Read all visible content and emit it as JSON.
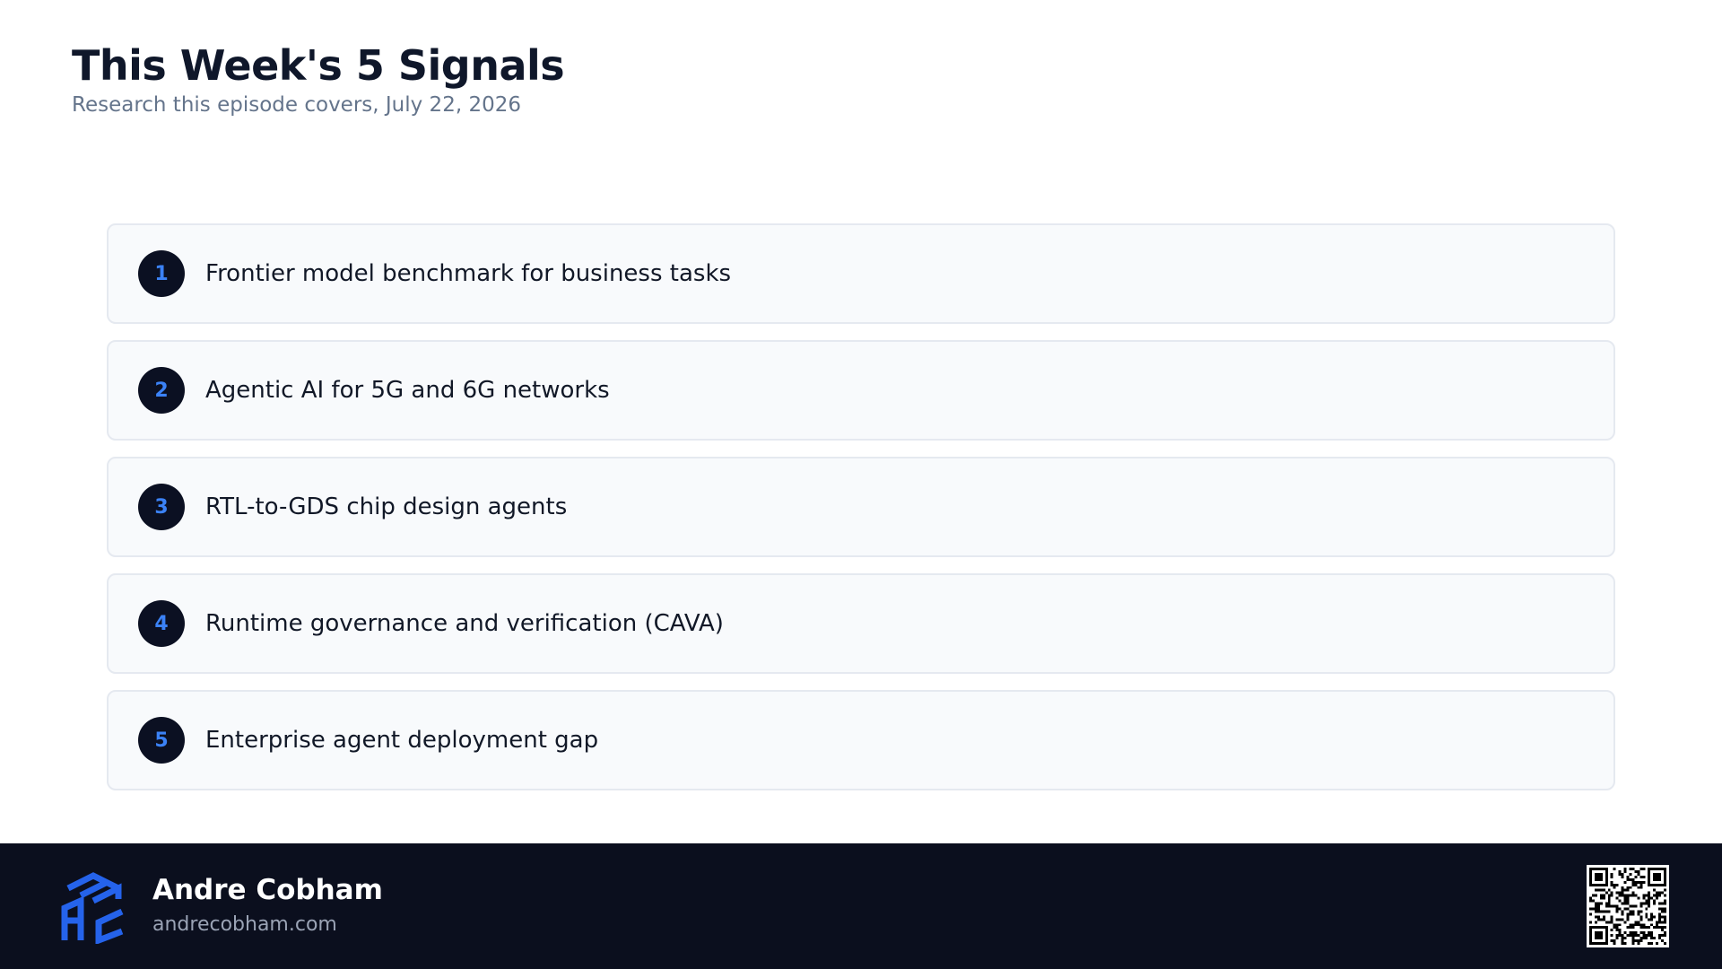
{
  "header": {
    "title": "This Week's 5 Signals",
    "subtitle": "Research this episode covers, July 22, 2026"
  },
  "signals": [
    {
      "number": "1",
      "label": "Frontier model benchmark for business tasks"
    },
    {
      "number": "2",
      "label": "Agentic AI for 5G and 6G networks"
    },
    {
      "number": "3",
      "label": "RTL-to-GDS chip design agents"
    },
    {
      "number": "4",
      "label": "Runtime governance and verification (CAVA)"
    },
    {
      "number": "5",
      "label": "Enterprise agent deployment gap"
    }
  ],
  "footer": {
    "name": "Andre Cobham",
    "website": "andrecobham.com",
    "logo_icon": "cube-ac-logo-icon",
    "qr_icon": "qr-code-icon"
  },
  "colors": {
    "accent": "#3b82f6",
    "dark": "#0b0f1e",
    "card_bg": "#f8fafc"
  }
}
